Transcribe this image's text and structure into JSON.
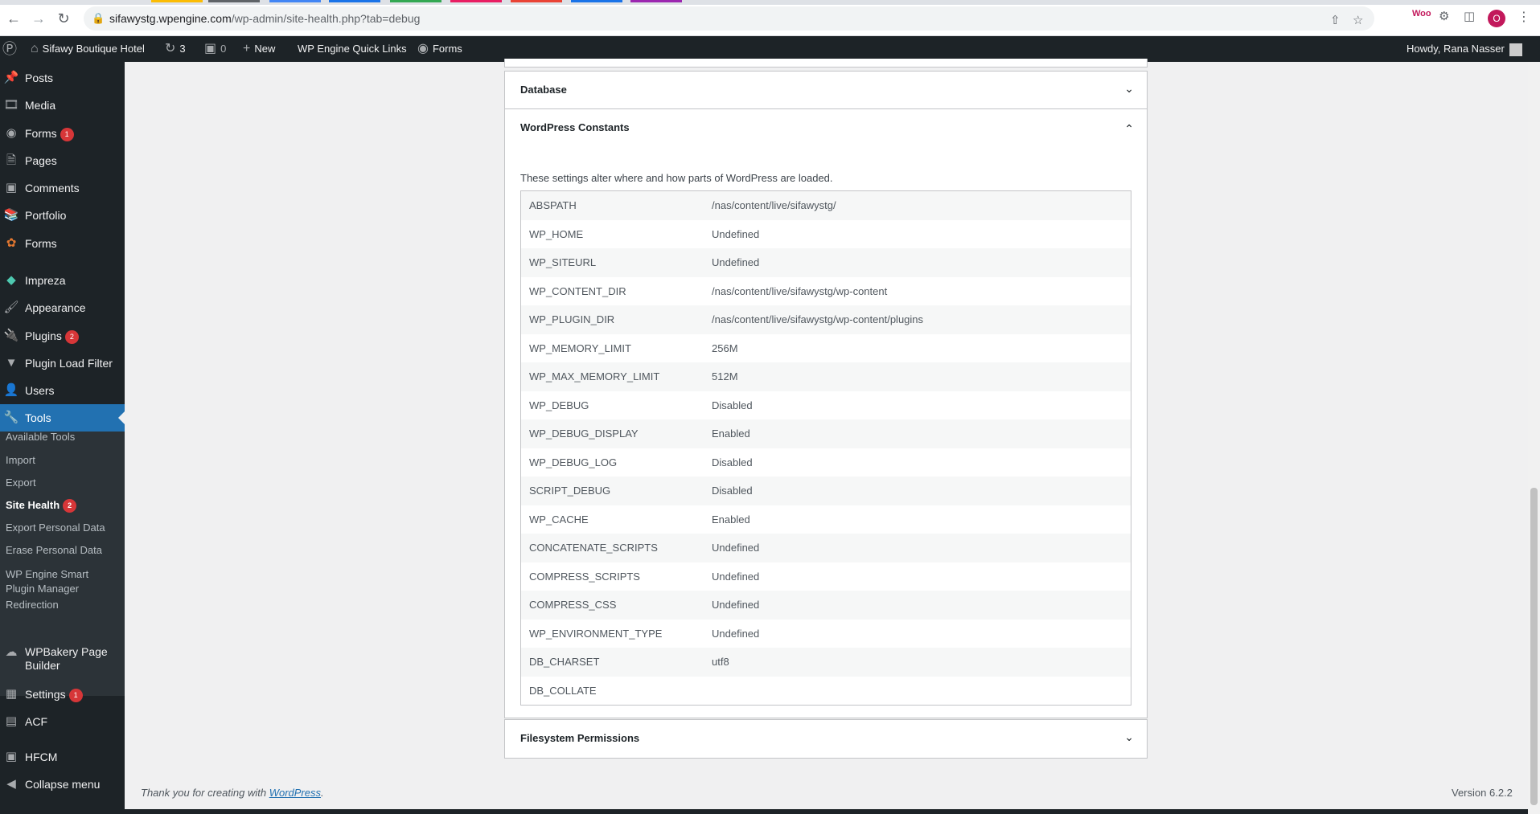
{
  "browser": {
    "tab_colors": [
      "#fbbc04",
      "#5f6368",
      "#4285f4",
      "#1a73e8",
      "#34a853",
      "#e91e63",
      "#ea4335",
      "#1a73e8",
      "#9c27b0"
    ],
    "url_host": "sifawystg.wpengine.com",
    "url_path": "/wp-admin/site-health.php?tab=debug",
    "profile_initial": "O"
  },
  "adminbar": {
    "site_name": "Sifawy Boutique Hotel",
    "updates_count": "3",
    "comments_count": "0",
    "new_label": "New",
    "quick_links_label": "WP Engine Quick Links",
    "forms_label": "Forms",
    "howdy": "Howdy, Rana Nasser"
  },
  "sidebar": {
    "items": [
      {
        "label": "Posts",
        "icon": "pin-icon"
      },
      {
        "label": "Media",
        "icon": "media-icon"
      },
      {
        "label": "Forms",
        "icon": "forms-icon",
        "badge": "1"
      },
      {
        "label": "Pages",
        "icon": "pages-icon"
      },
      {
        "label": "Comments",
        "icon": "comments-icon"
      },
      {
        "label": "Portfolio",
        "icon": "portfolio-icon"
      },
      {
        "label": "Forms",
        "icon": "wpforms-icon"
      },
      {
        "label": "Impreza",
        "icon": "impreza-icon"
      },
      {
        "label": "Appearance",
        "icon": "brush-icon"
      },
      {
        "label": "Plugins",
        "icon": "plugin-icon",
        "badge": "2"
      },
      {
        "label": "Plugin Load Filter",
        "icon": "filter-icon"
      },
      {
        "label": "Users",
        "icon": "users-icon"
      },
      {
        "label": "Tools",
        "icon": "wrench-icon"
      }
    ],
    "submenu": [
      {
        "label": "Available Tools"
      },
      {
        "label": "Import"
      },
      {
        "label": "Export"
      },
      {
        "label": "Site Health",
        "badge": "2"
      },
      {
        "label": "Export Personal Data"
      },
      {
        "label": "Erase Personal Data"
      },
      {
        "label": "WP Engine Smart\nPlugin Manager"
      },
      {
        "label": "Redirection"
      }
    ],
    "after_items": [
      {
        "label": "WPBakery Page\nBuilder",
        "icon": "wpbakery-icon"
      },
      {
        "label": "Settings",
        "icon": "settings-icon",
        "badge": "1"
      },
      {
        "label": "ACF",
        "icon": "acf-icon"
      },
      {
        "label": "HFCM",
        "icon": "robot-icon"
      },
      {
        "label": "Collapse menu",
        "icon": "collapse-icon"
      }
    ]
  },
  "main": {
    "database_title": "Database",
    "constants_title": "WordPress Constants",
    "constants_desc": "These settings alter where and how parts of WordPress are loaded.",
    "constants": [
      {
        "key": "ABSPATH",
        "value": "/nas/content/live/sifawystg/"
      },
      {
        "key": "WP_HOME",
        "value": "Undefined"
      },
      {
        "key": "WP_SITEURL",
        "value": "Undefined"
      },
      {
        "key": "WP_CONTENT_DIR",
        "value": "/nas/content/live/sifawystg/wp-content"
      },
      {
        "key": "WP_PLUGIN_DIR",
        "value": "/nas/content/live/sifawystg/wp-content/plugins"
      },
      {
        "key": "WP_MEMORY_LIMIT",
        "value": "256M"
      },
      {
        "key": "WP_MAX_MEMORY_LIMIT",
        "value": "512M"
      },
      {
        "key": "WP_DEBUG",
        "value": "Disabled"
      },
      {
        "key": "WP_DEBUG_DISPLAY",
        "value": "Enabled"
      },
      {
        "key": "WP_DEBUG_LOG",
        "value": "Disabled"
      },
      {
        "key": "SCRIPT_DEBUG",
        "value": "Disabled"
      },
      {
        "key": "WP_CACHE",
        "value": "Enabled"
      },
      {
        "key": "CONCATENATE_SCRIPTS",
        "value": "Undefined"
      },
      {
        "key": "COMPRESS_SCRIPTS",
        "value": "Undefined"
      },
      {
        "key": "COMPRESS_CSS",
        "value": "Undefined"
      },
      {
        "key": "WP_ENVIRONMENT_TYPE",
        "value": "Undefined"
      },
      {
        "key": "DB_CHARSET",
        "value": "utf8"
      },
      {
        "key": "DB_COLLATE",
        "value": ""
      }
    ],
    "filesystem_title": "Filesystem Permissions"
  },
  "footer": {
    "thanks_prefix": "Thank you for creating with ",
    "thanks_link": "WordPress",
    "thanks_suffix": ".",
    "version": "Version 6.2.2"
  }
}
